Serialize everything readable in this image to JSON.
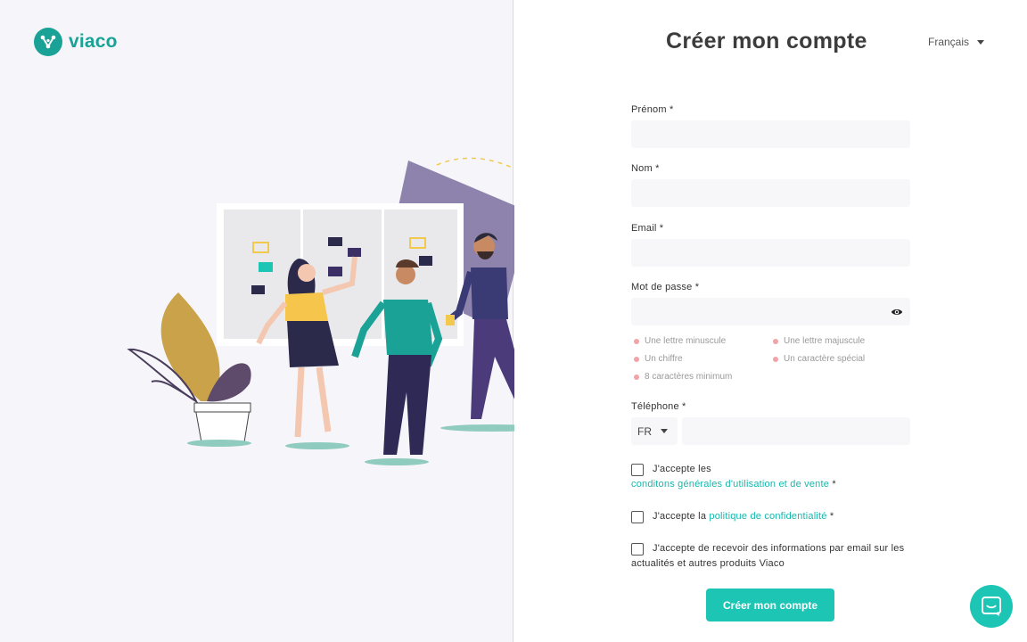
{
  "brand": {
    "name": "viaco",
    "color": "#1aa296",
    "accent": "#1cc5b4"
  },
  "header": {
    "title": "Créer mon compte",
    "language": "Français"
  },
  "form": {
    "first_name": {
      "label": "Prénom *",
      "value": ""
    },
    "last_name": {
      "label": "Nom *",
      "value": ""
    },
    "email": {
      "label": "Email *",
      "value": ""
    },
    "password": {
      "label": "Mot de passe *",
      "value": "",
      "toggle_icon": "eye-icon",
      "rules": [
        "Une lettre minuscule",
        "Une lettre majuscule",
        "Un chiffre",
        "Un caractère spécial",
        "8 caractères minimum"
      ]
    },
    "phone": {
      "label": "Téléphone *",
      "country": "FR",
      "value": ""
    },
    "consents": {
      "terms": {
        "prefix": "J'accepte les",
        "link": "conditons générales d'utilisation et de vente",
        "suffix": " *",
        "checked": false
      },
      "privacy": {
        "prefix": "J'accepte la ",
        "link": "politique de confidentialité",
        "suffix": " *",
        "checked": false
      },
      "newsletter": {
        "text": "J'accepte de recevoir des informations par email sur les actualités et autres produits Viaco",
        "checked": false
      }
    },
    "submit_label": "Créer mon compte"
  },
  "support": {
    "icon": "chat-icon"
  }
}
